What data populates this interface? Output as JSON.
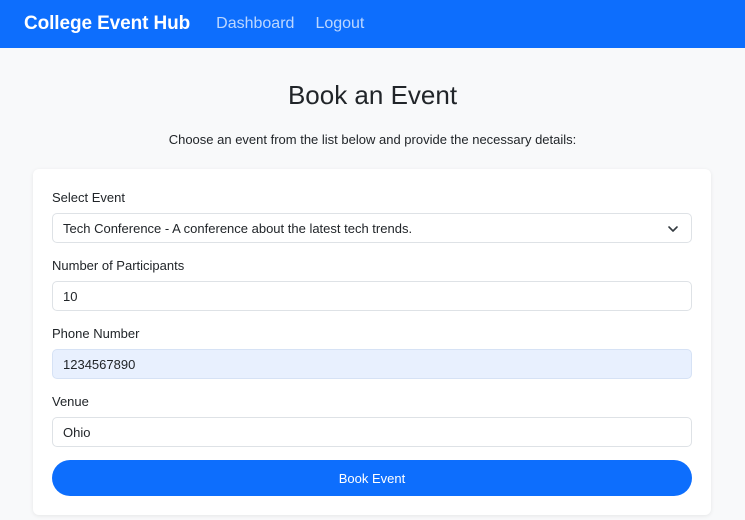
{
  "navbar": {
    "brand": "College Event Hub",
    "links": [
      "Dashboard",
      "Logout"
    ]
  },
  "page": {
    "title": "Book an Event",
    "subtitle": "Choose an event from the list below and provide the necessary details:"
  },
  "form": {
    "event": {
      "label": "Select Event",
      "selected": "Tech Conference - A conference about the latest tech trends."
    },
    "participants": {
      "label": "Number of Participants",
      "value": "10"
    },
    "phone": {
      "label": "Phone Number",
      "value": "1234567890"
    },
    "venue": {
      "label": "Venue",
      "value": "Ohio"
    },
    "submit_label": "Book Event"
  },
  "colors": {
    "primary": "#0d6efd",
    "background": "#f8f9fa",
    "autofill": "#e8f0fe"
  },
  "icons": {
    "select": "chevron-down-icon"
  }
}
